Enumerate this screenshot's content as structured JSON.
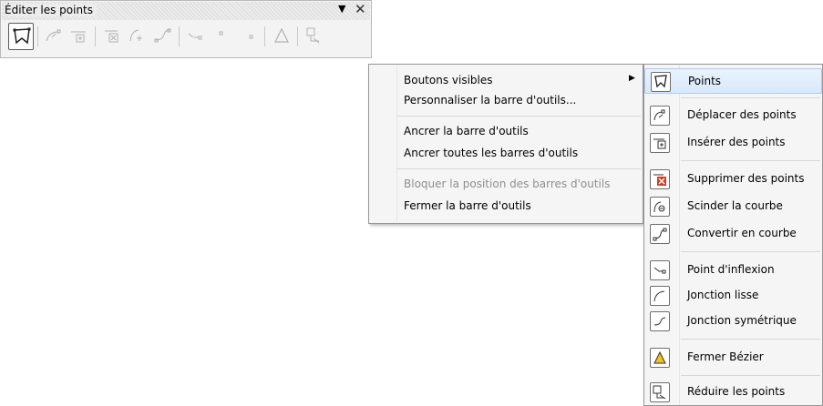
{
  "toolbar": {
    "title": "Éditer les points",
    "menu_arrow": "▼",
    "close": "✕"
  },
  "context_menu": {
    "items": [
      {
        "label": "Boutons visibles",
        "has_submenu": true
      },
      {
        "label": "Personnaliser la barre d'outils..."
      },
      {
        "label": "Ancrer la barre d'outils"
      },
      {
        "label": "Ancrer toutes les barres d'outils"
      },
      {
        "label": "Bloquer la position des barres d'outils",
        "disabled": true
      },
      {
        "label": "Fermer la barre d'outils"
      }
    ],
    "submenu_arrow": "▶"
  },
  "submenu": {
    "items": [
      {
        "label": "Points",
        "icon": "points-icon",
        "highlighted": true
      },
      {
        "label": "Déplacer des points",
        "icon": "move-points-icon"
      },
      {
        "label": "Insérer des points",
        "icon": "insert-points-icon"
      },
      {
        "label": "Supprimer des points",
        "icon": "delete-points-icon"
      },
      {
        "label": "Scinder la courbe",
        "icon": "split-curve-icon"
      },
      {
        "label": "Convertir en courbe",
        "icon": "convert-curve-icon"
      },
      {
        "label": "Point d'inflexion",
        "icon": "corner-point-icon"
      },
      {
        "label": "Jonction lisse",
        "icon": "smooth-transition-icon"
      },
      {
        "label": "Jonction symétrique",
        "icon": "symmetric-transition-icon"
      },
      {
        "label": "Fermer Bézier",
        "icon": "close-bezier-icon"
      },
      {
        "label": "Réduire les points",
        "icon": "eliminate-points-icon"
      }
    ]
  },
  "colors": {
    "accent_red": "#d63a1e",
    "accent_yellow": "#f2c21c",
    "highlight_border": "#a9cbf4"
  }
}
